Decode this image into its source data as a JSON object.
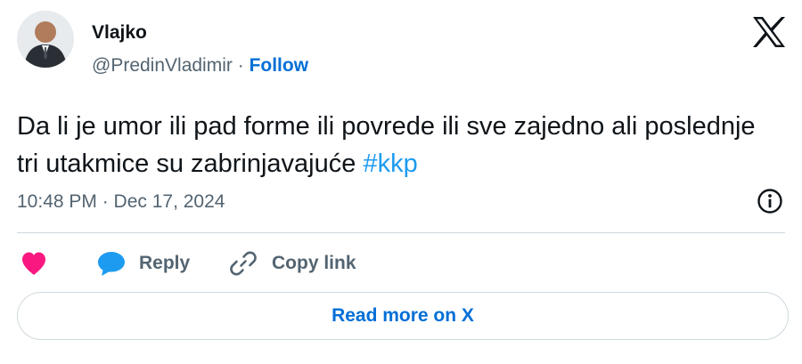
{
  "author": {
    "display_name": "Vlajko",
    "handle": "@PredinVladimir",
    "separator": "·",
    "follow_label": "Follow"
  },
  "tweet": {
    "text": "Da li je umor ili pad forme ili povrede ili sve zajedno ali poslednje tri utakmice su zabrinjavajuće",
    "hashtag": "#kkp",
    "timestamp": "10:48 PM · Dec 17, 2024"
  },
  "actions": {
    "reply_label": "Reply",
    "copy_link_label": "Copy link"
  },
  "footer": {
    "read_more_label": "Read more on X"
  },
  "icons": {
    "brand": "x-logo-icon",
    "info": "info-icon",
    "like": "heart-icon",
    "reply": "speech-bubble-icon",
    "copy": "link-icon"
  },
  "colors": {
    "follow": "#006fd6",
    "hashtag": "#1d9bf0",
    "heart": "#f91880",
    "reply_bubble": "#1d9bf0",
    "secondary_text": "#536471",
    "border": "#cfd9de"
  }
}
